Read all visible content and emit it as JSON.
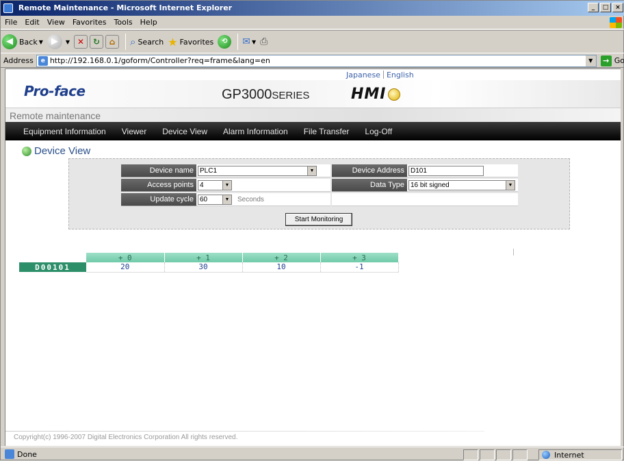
{
  "window": {
    "title": "Remote Maintenance - Microsoft Internet Explorer",
    "controls": [
      "_",
      "□",
      "×"
    ]
  },
  "menu": [
    "File",
    "Edit",
    "View",
    "Favorites",
    "Tools",
    "Help"
  ],
  "toolbar": {
    "back": "Back",
    "search": "Search",
    "favorites": "Favorites"
  },
  "address": {
    "label": "Address",
    "url": "http://192.168.0.1/goform/Controller?req=frame&lang=en",
    "go": "Go"
  },
  "page": {
    "lang": {
      "japanese": "Japanese",
      "english": "English"
    },
    "brand": "Pro-face",
    "series_main": "GP3000",
    "series_suffix": "SERIES",
    "hmi": "HMI",
    "subtitle": "Remote maintenance",
    "nav": [
      "Equipment Information",
      "Viewer",
      "Device View",
      "Alarm Information",
      "File Transfer",
      "Log-Off"
    ],
    "section_title": "Device View",
    "form": {
      "device_name_label": "Device name",
      "device_name_value": "PLC1",
      "device_address_label": "Device Address",
      "device_address_value": "D101",
      "access_points_label": "Access points",
      "access_points_value": "4",
      "data_type_label": "Data Type",
      "data_type_value": "16 bit signed",
      "update_cycle_label": "Update cycle",
      "update_cycle_value": "60",
      "update_cycle_unit": "Seconds",
      "start_button": "Start Monitoring"
    },
    "monitor": {
      "headers": [
        "+ 0",
        "+ 1",
        "+ 2",
        "+ 3"
      ],
      "row_address": "D00101",
      "values": [
        "20",
        "30",
        "10",
        "-1"
      ]
    },
    "footer": "Copyright(c) 1996-2007 Digital Electronics Corporation All rights reserved."
  },
  "status": {
    "text": "Done",
    "zone": "Internet"
  }
}
